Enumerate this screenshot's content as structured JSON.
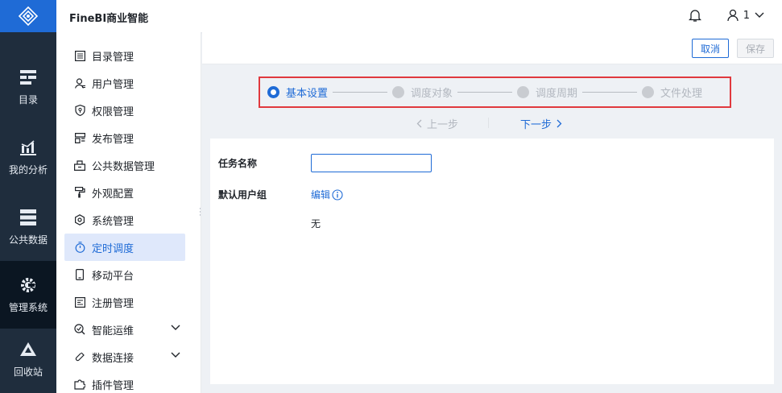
{
  "app": {
    "title": "FineBI商业智能"
  },
  "user": {
    "name": "1"
  },
  "rail": {
    "items": [
      {
        "key": "catalog",
        "label": "目录",
        "icon": "catalog-icon"
      },
      {
        "key": "analysis",
        "label": "我的分析",
        "icon": "analysis-chart-icon"
      },
      {
        "key": "public-data",
        "label": "公共数据",
        "icon": "database-icon"
      },
      {
        "key": "system",
        "label": "管理系统",
        "icon": "gear-icon",
        "active": true
      },
      {
        "key": "recycle",
        "label": "回收站",
        "icon": "recycle-icon"
      }
    ]
  },
  "subnav": {
    "items": [
      {
        "label": "目录管理",
        "icon": "list-icon"
      },
      {
        "label": "用户管理",
        "icon": "user-icon"
      },
      {
        "label": "权限管理",
        "icon": "shield-icon"
      },
      {
        "label": "发布管理",
        "icon": "publish-icon"
      },
      {
        "label": "公共数据管理",
        "icon": "data-box-icon"
      },
      {
        "label": "外观配置",
        "icon": "paint-roller-icon"
      },
      {
        "label": "系统管理",
        "icon": "settings-icon"
      },
      {
        "label": "定时调度",
        "icon": "timer-icon",
        "active": true
      },
      {
        "label": "移动平台",
        "icon": "mobile-icon"
      },
      {
        "label": "注册管理",
        "icon": "register-icon"
      },
      {
        "label": "智能运维",
        "icon": "ops-icon",
        "expandable": true
      },
      {
        "label": "数据连接",
        "icon": "link-icon",
        "expandable": true
      },
      {
        "label": "插件管理",
        "icon": "plugin-icon"
      }
    ]
  },
  "actions": {
    "cancel": "取消",
    "save": "保存"
  },
  "steps": [
    {
      "label": "基本设置",
      "state": "active"
    },
    {
      "label": "调度对象",
      "state": "inactive"
    },
    {
      "label": "调度周期",
      "state": "inactive"
    },
    {
      "label": "文件处理",
      "state": "inactive"
    }
  ],
  "stepnav": {
    "prev": "上一步",
    "next": "下一步"
  },
  "form": {
    "task_name_label": "任务名称",
    "task_name_value": "",
    "default_group_label": "默认用户组",
    "edit_label": "编辑",
    "default_group_value": "无"
  },
  "colors": {
    "accent": "#1f6bd6",
    "rail_bg": "#1f2d3d",
    "highlight_border": "#e0393e"
  }
}
